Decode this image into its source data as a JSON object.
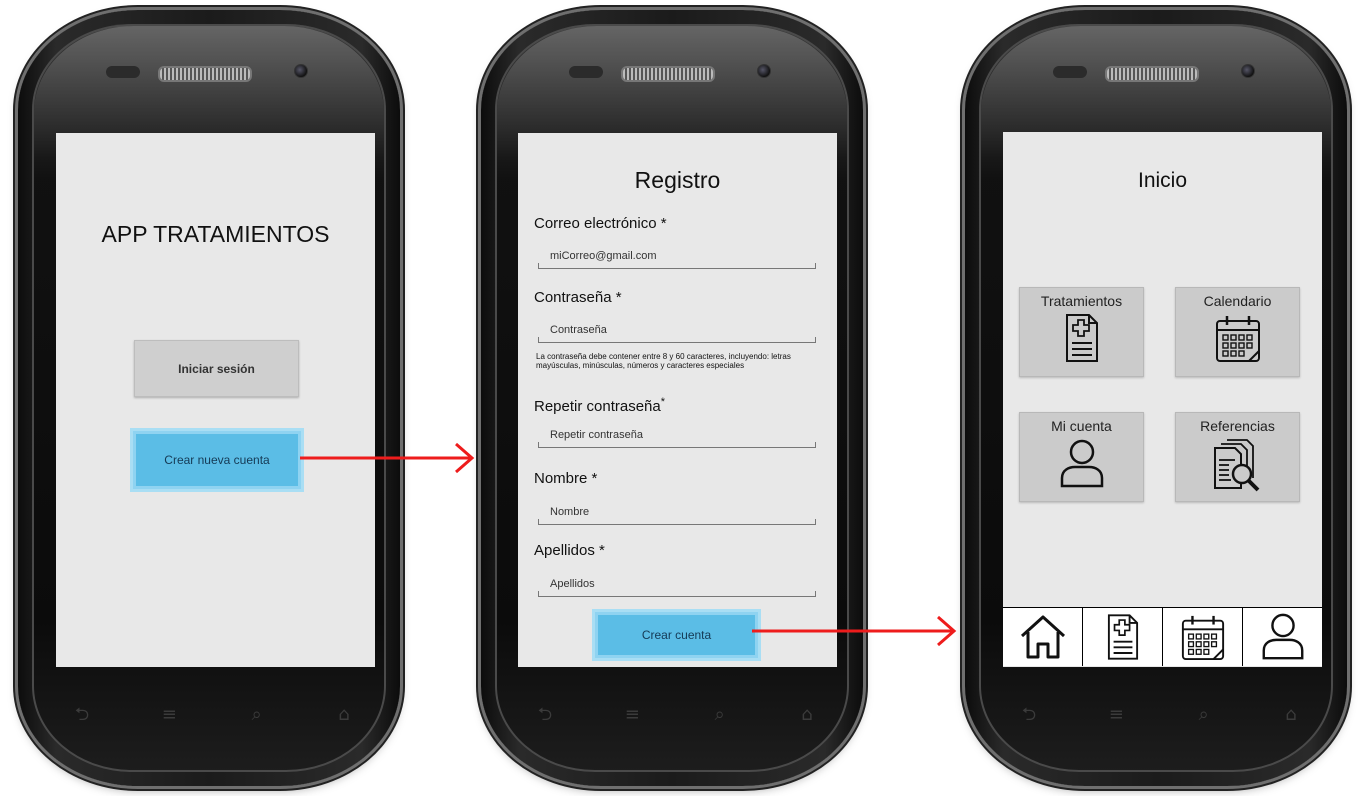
{
  "screen1": {
    "title": "APP TRATAMIENTOS",
    "login_button": "Iniciar sesión",
    "create_button": "Crear nueva cuenta"
  },
  "screen2": {
    "title": "Registro",
    "email_label": "Correo electrónico *",
    "email_value": "miCorreo@gmail.com",
    "password_label": "Contraseña  *",
    "password_placeholder": "Contraseña",
    "password_hint": "La contraseña debe contener entre 8 y 60 caracteres, incluyendo: letras mayúsculas, minúsculas, números y caracteres especiales",
    "repeat_label": "Repetir contraseña",
    "repeat_star": "*",
    "repeat_placeholder": "Repetir contraseña",
    "name_label": "Nombre *",
    "name_placeholder": "Nombre",
    "surname_label": "Apellidos *",
    "surname_placeholder": "Apellidos",
    "submit_button": "Crear cuenta"
  },
  "screen3": {
    "title": "Inicio",
    "tiles": [
      {
        "label": "Tratamientos",
        "icon": "medical-report-icon"
      },
      {
        "label": "Calendario",
        "icon": "calendar-icon"
      },
      {
        "label": "Mi cuenta",
        "icon": "user-icon"
      },
      {
        "label": "Referencias",
        "icon": "document-search-icon"
      }
    ],
    "bottom_nav": [
      "home-icon",
      "medical-report-icon",
      "calendar-icon",
      "user-icon"
    ]
  },
  "softkeys": [
    "back-icon",
    "menu-icon",
    "search-icon",
    "home-softkey-icon"
  ],
  "colors": {
    "screen_bg": "#e8e8e8",
    "primary_button": "#5bbde6",
    "secondary_button": "#cfcfcf",
    "arrow": "#ee1c1c"
  }
}
